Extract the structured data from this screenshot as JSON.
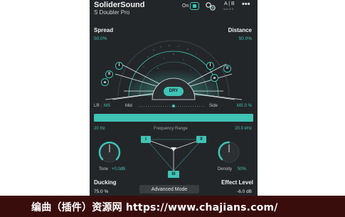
{
  "header": {
    "brand": "SoliderSound",
    "product": "S Doubler Pro",
    "power_label": "On",
    "ab_label": "A | B",
    "ab_sub": "Auto fit B",
    "more": "•••"
  },
  "spread": {
    "label": "Spread",
    "value": "50.0%"
  },
  "distance": {
    "label": "Distance",
    "value": "50.0%"
  },
  "voices": {
    "left": [
      "I",
      "II",
      "III"
    ],
    "right": [
      "I",
      "II",
      "III"
    ],
    "dry": "DRY"
  },
  "stereo": {
    "mode_lr": "LR",
    "mode_ms": "MS",
    "mid_label": "Mid",
    "side_label": "Side",
    "ms_value": "MS 0 %",
    "level": 0.5
  },
  "frequency": {
    "low": "20 Hz",
    "label": "Frequency Range",
    "high": "20.0 kHz"
  },
  "tone": {
    "label": "Tone",
    "value": "+0.0dB"
  },
  "density": {
    "label": "Density",
    "value": "50%"
  },
  "voice_selector": {
    "left": "I",
    "right": "II",
    "bottom": "III"
  },
  "ducking": {
    "label": "Ducking",
    "value": "75.0 %"
  },
  "advanced_mode_label": "Advanced Mode",
  "effect_level": {
    "label": "Effect Level",
    "value": "-6.0 dB"
  },
  "watermark": "编曲（插件）资源网  https://www.chajians.com/",
  "colors": {
    "accent": "#3fc3b4",
    "panel": "#232629",
    "banner": "#3a0d0d"
  }
}
